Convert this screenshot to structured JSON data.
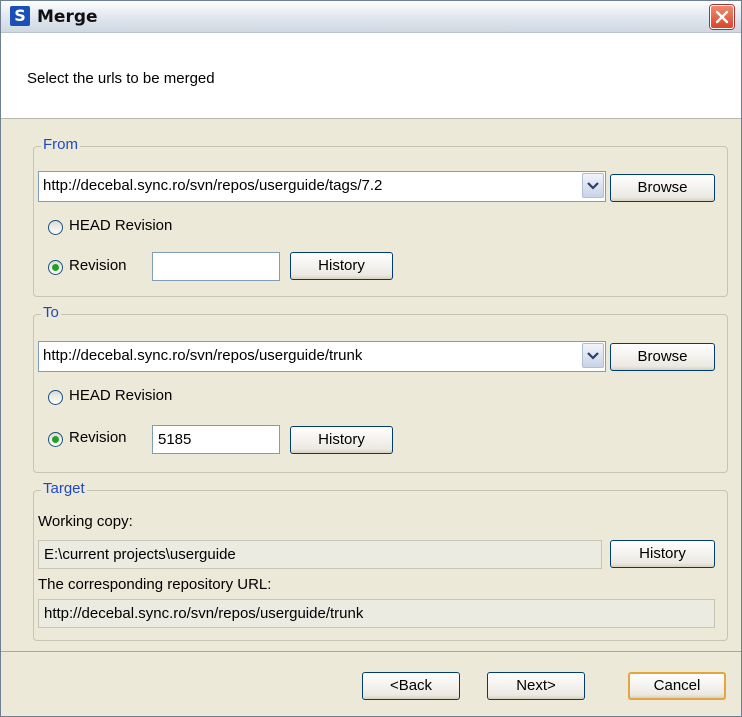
{
  "window": {
    "title": "Merge",
    "app_icon_letter": "S"
  },
  "header": {
    "subtitle": "Select the urls to be merged"
  },
  "from": {
    "legend": "From",
    "url": "http://decebal.sync.ro/svn/repos/userguide/tags/7.2",
    "browse_label": "Browse",
    "head_revision_label": "HEAD Revision",
    "revision_label": "Revision",
    "revision_value": "",
    "history_label": "History",
    "selected": "revision"
  },
  "to": {
    "legend": "To",
    "url": "http://decebal.sync.ro/svn/repos/userguide/trunk",
    "browse_label": "Browse",
    "head_revision_label": "HEAD Revision",
    "revision_label": "Revision",
    "revision_value": "5185",
    "history_label": "History",
    "selected": "revision"
  },
  "target": {
    "legend": "Target",
    "working_copy_label": "Working copy:",
    "working_copy_value": "E:\\current projects\\userguide",
    "history_label": "History",
    "repo_url_label": "The corresponding repository URL:",
    "repo_url_value": "http://decebal.sync.ro/svn/repos/userguide/trunk"
  },
  "footer": {
    "back_label": "<Back",
    "next_label": "Next>",
    "cancel_label": "Cancel"
  },
  "colors": {
    "legend": "#1f49c4",
    "radio_selected": "#22a022",
    "close_button": "#d9462a"
  },
  "icons": [
    "app-icon",
    "close-icon",
    "dropdown-arrow-icon"
  ]
}
